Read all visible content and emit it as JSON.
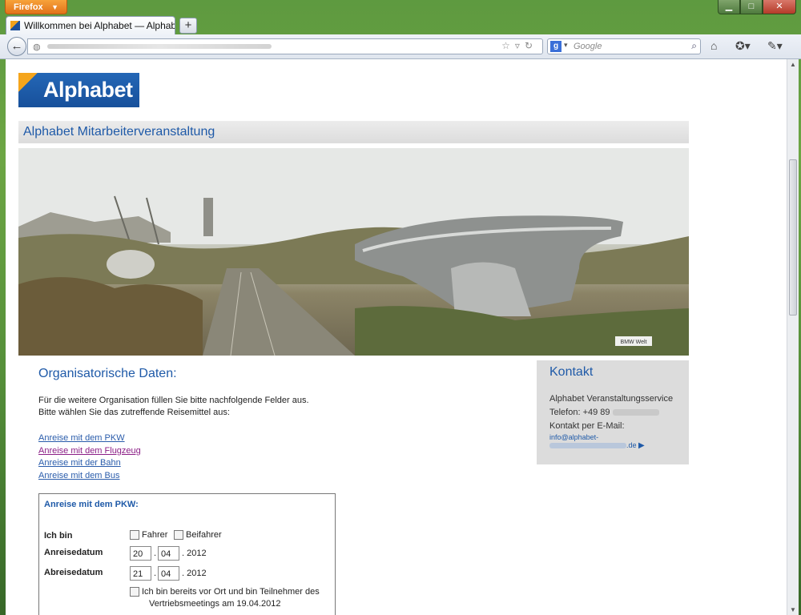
{
  "browser": {
    "app_button": "Firefox",
    "tab_title": "Willkommen bei Alphabet — Alphabet ...",
    "new_tab": "+",
    "search_placeholder": "Google",
    "window_controls": {
      "minimize": "▁",
      "maximize": "□",
      "close": "✕"
    }
  },
  "page": {
    "logo": "Alphabet",
    "header_title": "Alphabet Mitarbeiterveranstaltung",
    "hero_sign": "BMW Welt",
    "section_title": "Organisatorische Daten:",
    "intro_line1": "Für die weitere Organisation füllen Sie bitte nachfolgende Felder aus.",
    "intro_line2": "Bitte wählen Sie das zutreffende Reisemittel aus:",
    "links": [
      {
        "label": "Anreise mit dem PKW",
        "visited": false
      },
      {
        "label": "Anreise mit dem Flugzeug",
        "visited": true
      },
      {
        "label": "Anreise mit der Bahn",
        "visited": false
      },
      {
        "label": "Anreise mit dem Bus",
        "visited": false
      }
    ],
    "contact": {
      "title": "Kontakt",
      "company": "Alphabet Veranstaltungsservice",
      "phone_label": "Telefon: +49 89",
      "email_label": "Kontakt per E-Mail:",
      "email_prefix": "info@alphabet-",
      "email_suffix": ".de"
    },
    "form": {
      "title": "Anreise mit dem PKW:",
      "ich_bin_label": "Ich bin",
      "option_fahrer": "Fahrer",
      "option_beifahrer": "Beifahrer",
      "anreise_label": "Anreisedatum",
      "anreise_day": "20",
      "anreise_month": "04",
      "anreise_year": "2012",
      "abreise_label": "Abreisedatum",
      "abreise_day": "21",
      "abreise_month": "04",
      "abreise_year": "2012",
      "note_line1": "Ich bin bereits vor Ort und bin Teilnehmer des",
      "note_line2": "Vertriebsmeetings am 19.04.2012"
    }
  }
}
